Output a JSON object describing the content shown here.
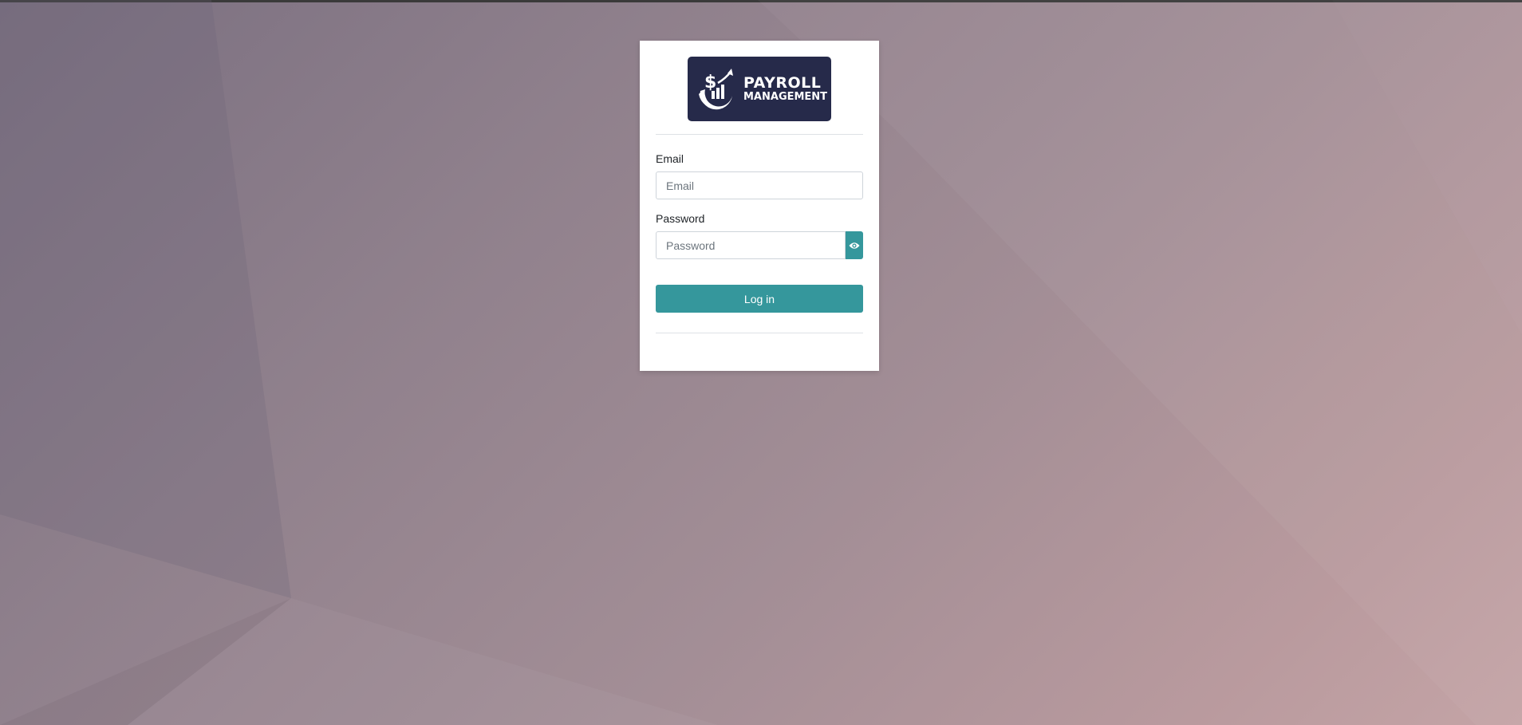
{
  "colors": {
    "accent": "#35979c",
    "logo_bg": "#262a4a",
    "card_bg": "#ffffff"
  },
  "logo": {
    "line1": "PAYROLL",
    "line2": "MANAGEMENT",
    "icon": "payroll-logo-icon"
  },
  "form": {
    "email_label": "Email",
    "email_placeholder": "Email",
    "email_value": "",
    "password_label": "Password",
    "password_placeholder": "Password",
    "password_value": "",
    "show_password_icon": "eye-icon",
    "login_label": "Log in"
  }
}
